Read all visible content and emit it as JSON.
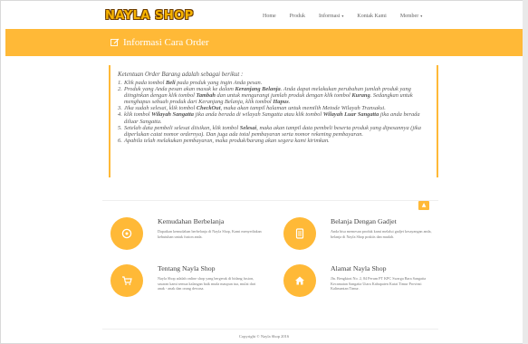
{
  "brand": {
    "logo_text": "NAYLA SHOP"
  },
  "nav": {
    "items": [
      {
        "label": "Home",
        "has_dropdown": false
      },
      {
        "label": "Produk",
        "has_dropdown": false
      },
      {
        "label": "Informasi",
        "has_dropdown": true
      },
      {
        "label": "Kontak Kami",
        "has_dropdown": false
      },
      {
        "label": "Member",
        "has_dropdown": true
      }
    ]
  },
  "header": {
    "title": "Informasi Cara Order",
    "icon": "edit-icon"
  },
  "order_info": {
    "intro": "Ketentuan Order Barang adalah sebagai berikut :",
    "rules": [
      {
        "num": "1.",
        "parts": [
          [
            "t",
            "Klik pada tombol "
          ],
          [
            "b",
            "Beli"
          ],
          [
            "t",
            " pada produk yang ingin Anda pesan."
          ]
        ]
      },
      {
        "num": "2.",
        "parts": [
          [
            "t",
            "Produk yang Anda pesan akan masuk ke dalam "
          ],
          [
            "b",
            "Keranjang Belanja"
          ],
          [
            "t",
            ". Anda dapat melakukan perubahan jumlah produk yang diinginkan dengan klik tombol "
          ],
          [
            "b",
            "Tambah"
          ],
          [
            "t",
            " dan untuk mengurangi jumlah produk dengan klik tombol "
          ],
          [
            "b",
            "Kurang"
          ],
          [
            "t",
            ". Sedangkan untuk menghapus sebuah produk dari Keranjang Belanja, klik tombol "
          ],
          [
            "b",
            "Hapus"
          ],
          [
            "t",
            "."
          ]
        ]
      },
      {
        "num": "3.",
        "parts": [
          [
            "t",
            "Jika sudah selesai, klik tombol "
          ],
          [
            "b",
            "CheckOut"
          ],
          [
            "t",
            ", maka akan tampil halaman untuk memilih Metode Wilayah Transaksi."
          ]
        ]
      },
      {
        "num": "4.",
        "parts": [
          [
            "t",
            "klik tombol "
          ],
          [
            "b",
            "Wilayah Sangatta"
          ],
          [
            "t",
            " jika anda berada di wilayah Sangatta atau klik tombol "
          ],
          [
            "b",
            "Wilayah Luar Sangatta"
          ],
          [
            "t",
            " jika anda berada diluar Sangatta."
          ]
        ]
      },
      {
        "num": "5.",
        "parts": [
          [
            "t",
            "Setelah data pembeli selesai diisikan, klik tombol "
          ],
          [
            "b",
            "Selesai"
          ],
          [
            "t",
            ", maka akan tampil data pembeli beserta produk yang dipesannya (jika diperlukan catat nomor ordernya). Dan juga ada total pembayaran serta nomor rekening pembayaran."
          ]
        ]
      },
      {
        "num": "6.",
        "parts": [
          [
            "t",
            "Apabila telah melakukan pembayaran, maka produk/barang akan segera kami kirimkan."
          ]
        ]
      }
    ]
  },
  "features": [
    {
      "title": "Kemudahan Berbelanja",
      "desc": "Dapatkan kemudahan berbelanja di Nayla Shop, Kami menyediakan kebutuhan untuk fusion anda.",
      "icon": "target-icon"
    },
    {
      "title": "Belanja Dengan Gadjet",
      "desc": "Anda bisa memesan produk kami melalui gadjet kesayangan anda, belanja di Nayla Shop praktis dan mudah.",
      "icon": "tablet-icon"
    },
    {
      "title": "Tentang Nayla Shop",
      "desc": "Nayla Shop adalah online shop yang bergerak di bidang fusion, sasaran kami semua kalangan baik muda maupun tua, mulai dari anak - anak dan orang dewasa.",
      "icon": "cart-icon"
    },
    {
      "title": "Alamat Nayla Shop",
      "desc": "Jln. Bengkirai No. 2, 84 Perum PT KPC Swarga Bara Sangatta Kecamatan Sangatta Utara Kabupaten Kutai Timur Provinsi Kalimantan Timur.",
      "icon": "home-icon"
    }
  ],
  "scroll_top": {
    "icon": "chevron-up-icon"
  },
  "footer": {
    "copyright": "Copyright © Nayla Shop 2016"
  },
  "colors": {
    "accent": "#ffb937"
  }
}
